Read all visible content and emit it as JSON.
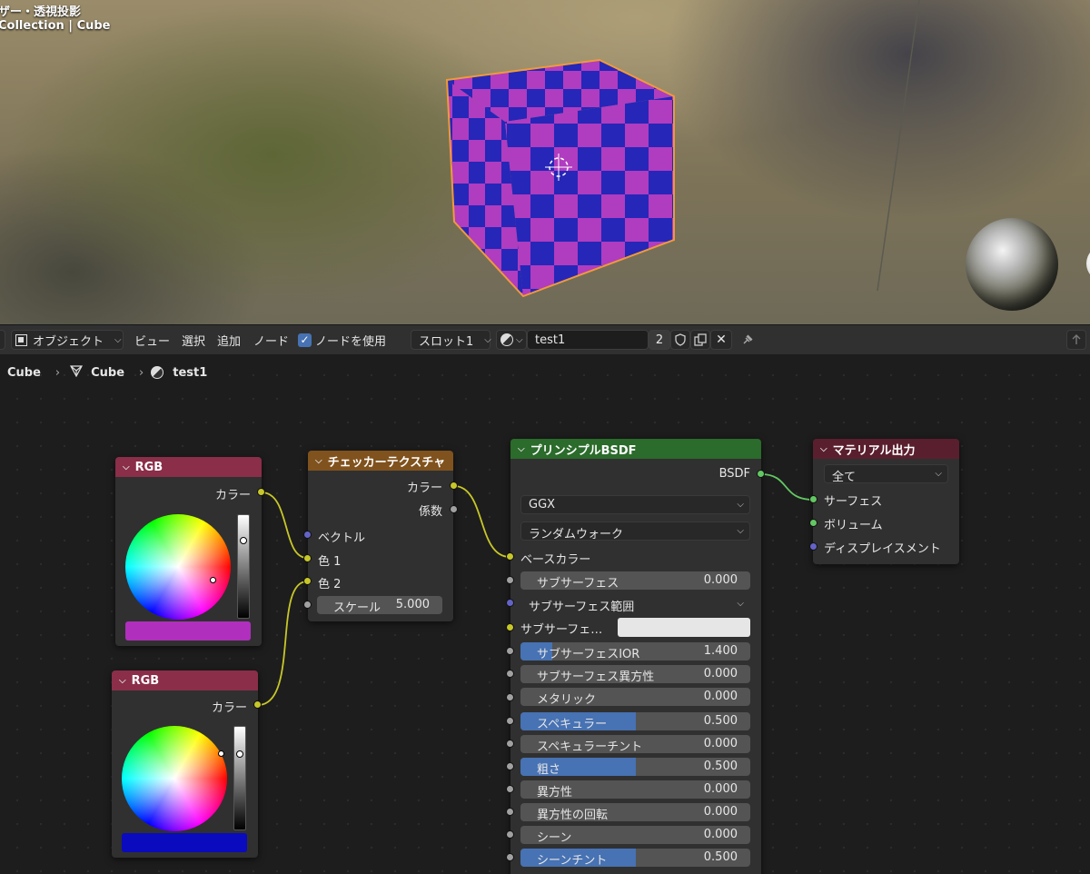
{
  "viewport": {
    "title_line": "ザー・透視投影",
    "collection_line": "Collection | Cube"
  },
  "header": {
    "mode": "オブジェクト",
    "menu": [
      "ビュー",
      "選択",
      "追加",
      "ノード"
    ],
    "use_nodes_label": "ノードを使用",
    "use_nodes_checked": true,
    "slot": "スロット1",
    "material_name": "test1",
    "user_count": "2"
  },
  "breadcrumb": {
    "object": "Cube",
    "mesh": "Cube",
    "material": "test1"
  },
  "nodes": {
    "rgb1": {
      "title": "RGB",
      "output": "カラー",
      "color": "#b02fbd"
    },
    "rgb2": {
      "title": "RGB",
      "output": "カラー",
      "color": "#0a0abf"
    },
    "checker": {
      "title": "チェッカーテクスチャ",
      "out_color": "カラー",
      "out_fac": "係数",
      "in_vector": "ベクトル",
      "in_color1": "色 1",
      "in_color2": "色 2",
      "scale_label": "スケール",
      "scale_value": "5.000"
    },
    "bsdf": {
      "title": "プリンシプルBSDF",
      "output": "BSDF",
      "distribution": "GGX",
      "subsurface_method": "ランダムウォーク",
      "base_color": "ベースカラー",
      "subsurface": {
        "label": "サブサーフェス",
        "value": "0.000",
        "fill": 0
      },
      "subsurface_radius": "サブサーフェス範囲",
      "subsurface_color": "サブサーフェ…",
      "subsurface_ior": {
        "label": "サブサーフェスIOR",
        "value": "1.400",
        "fill": 0.14
      },
      "subsurface_aniso": {
        "label": "サブサーフェス異方性",
        "value": "0.000",
        "fill": 0
      },
      "metallic": {
        "label": "メタリック",
        "value": "0.000",
        "fill": 0
      },
      "specular": {
        "label": "スペキュラー",
        "value": "0.500",
        "fill": 0.5
      },
      "specular_tint": {
        "label": "スペキュラーチント",
        "value": "0.000",
        "fill": 0
      },
      "roughness": {
        "label": "粗さ",
        "value": "0.500",
        "fill": 0.5
      },
      "anisotropic": {
        "label": "異方性",
        "value": "0.000",
        "fill": 0
      },
      "aniso_rotation": {
        "label": "異方性の回転",
        "value": "0.000",
        "fill": 0
      },
      "sheen": {
        "label": "シーン",
        "value": "0.000",
        "fill": 0
      },
      "sheen_tint": {
        "label": "シーンチント",
        "value": "0.500",
        "fill": 0.5
      }
    },
    "output": {
      "title": "マテリアル出力",
      "target": "全て",
      "surface": "サーフェス",
      "volume": "ボリューム",
      "displacement": "ディスプレイスメント"
    }
  },
  "colors": {
    "rgb_header": "#8a2e49",
    "texture_header": "#80521d",
    "shader_header": "#2b6b2b",
    "output_header": "#5a1f2e",
    "cube_a": "#b03cc0",
    "cube_b": "#2626b8",
    "selection": "#f09a3a"
  }
}
